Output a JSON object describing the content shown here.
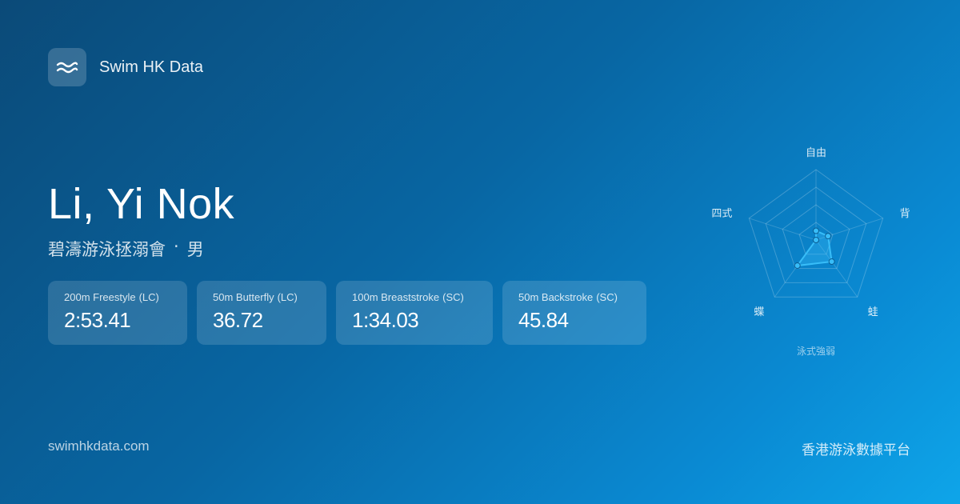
{
  "brand": {
    "icon": "waves-icon",
    "name": "Swim HK Data"
  },
  "swimmer": {
    "name": "Li, Yi Nok",
    "club": "碧濤游泳拯溺會",
    "separator": "·",
    "gender": "男"
  },
  "best_times": [
    {
      "event": "200m Freestyle",
      "course": "(LC)",
      "time": "2:53.41"
    },
    {
      "event": "50m Butterfly",
      "course": "(LC)",
      "time": "36.72"
    },
    {
      "event": "100m Breaststroke",
      "course": "(SC)",
      "time": "1:34.03"
    },
    {
      "event": "50m Backstroke",
      "course": "(SC)",
      "time": "45.84"
    }
  ],
  "chart_data": {
    "type": "radar",
    "title": "泳式強弱",
    "axes": [
      "自由",
      "背",
      "蛙",
      "蝶",
      "四式"
    ],
    "values": [
      0.13,
      0.18,
      0.38,
      0.45,
      0.0
    ],
    "max": 1.0,
    "rings": 4,
    "colors": {
      "fill": "#38bdf8",
      "stroke": "#38bdf8",
      "grid": "#ffffff"
    }
  },
  "footer": {
    "site": "swimhkdata.com",
    "tagline": "香港游泳數據平台"
  },
  "colors": {
    "background_start": "#0b4a78",
    "background_end": "#0ea5e9",
    "accent": "#38bdf8"
  }
}
